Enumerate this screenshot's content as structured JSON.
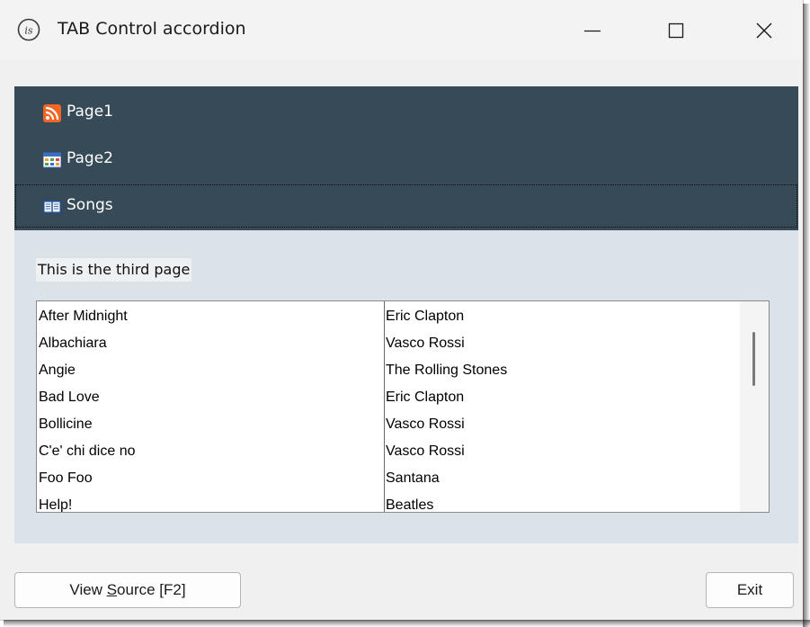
{
  "window": {
    "title": "TAB Control accordion",
    "app_icon": "is-logo-icon"
  },
  "accordion": {
    "items": [
      {
        "label": "Page1",
        "icon": "rss-feed-icon",
        "icon_color": "#f26522"
      },
      {
        "label": "Page2",
        "icon": "table-grid-icon",
        "icon_color": "#3b6fc4"
      },
      {
        "label": "Songs",
        "icon": "open-book-icon",
        "icon_color": "#3b6fc4",
        "active": true
      }
    ],
    "background": "#374a58"
  },
  "page": {
    "text": "This is the third page"
  },
  "songs": {
    "rows": [
      {
        "title": "After Midnight",
        "artist": "Eric Clapton"
      },
      {
        "title": "Albachiara",
        "artist": "Vasco Rossi"
      },
      {
        "title": "Angie",
        "artist": "The Rolling Stones"
      },
      {
        "title": "Bad Love",
        "artist": "Eric Clapton"
      },
      {
        "title": "Bollicine",
        "artist": "Vasco Rossi"
      },
      {
        "title": "C'e' chi dice no",
        "artist": "Vasco Rossi"
      },
      {
        "title": "Foo Foo",
        "artist": "Santana"
      },
      {
        "title": "Help!",
        "artist": "Beatles"
      }
    ]
  },
  "buttons": {
    "view_source_prefix": "View ",
    "view_source_mnemonic": "S",
    "view_source_suffix": "ource [F2]",
    "exit": "Exit"
  }
}
